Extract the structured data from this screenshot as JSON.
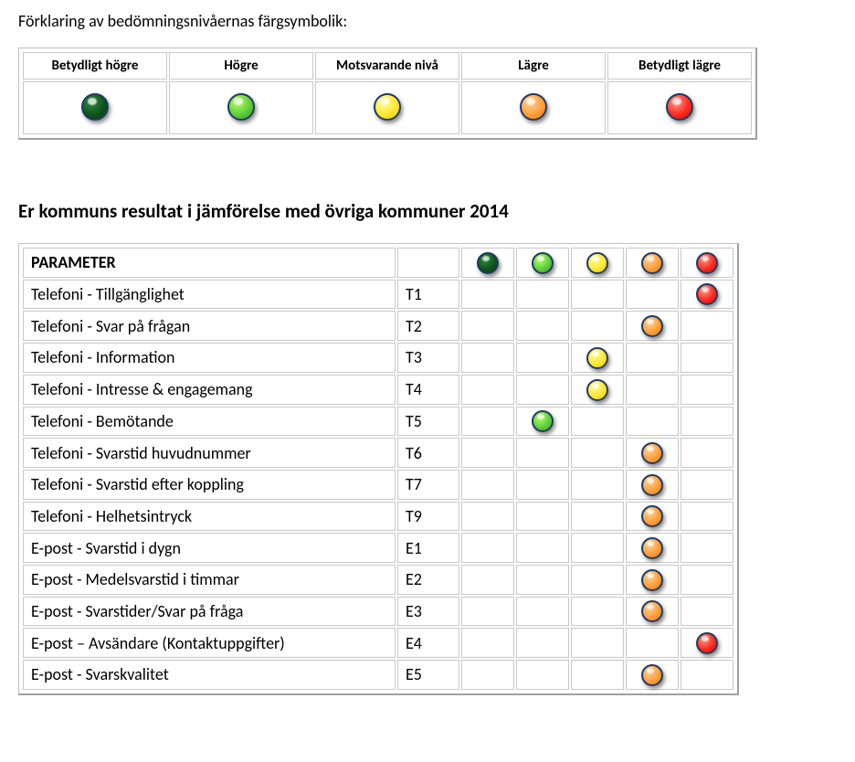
{
  "explain_text": "Förklaring av bedömningsnivåernas färgsymbolik:",
  "legend": {
    "headers": [
      "Betydligt högre",
      "Högre",
      "Motsvarande nivå",
      "Lägre",
      "Betydligt lägre"
    ],
    "colors": [
      "darkgreen",
      "green",
      "yellow",
      "orange",
      "red"
    ]
  },
  "results_heading": "Er kommuns resultat i jämförelse med övriga kommuner 2014",
  "table": {
    "header": {
      "label": "PARAMETER",
      "columns": [
        "darkgreen",
        "green",
        "yellow",
        "orange",
        "red"
      ]
    },
    "rows": [
      {
        "param": "Telefoni - Tillgänglighet",
        "code": "T1",
        "rating": "red"
      },
      {
        "param": "Telefoni - Svar på frågan",
        "code": "T2",
        "rating": "orange"
      },
      {
        "param": "Telefoni - Information",
        "code": "T3",
        "rating": "yellow"
      },
      {
        "param": "Telefoni - Intresse & engagemang",
        "code": "T4",
        "rating": "yellow"
      },
      {
        "param": "Telefoni - Bemötande",
        "code": "T5",
        "rating": "green"
      },
      {
        "param": "Telefoni - Svarstid huvudnummer",
        "code": "T6",
        "rating": "orange"
      },
      {
        "param": "Telefoni - Svarstid efter koppling",
        "code": "T7",
        "rating": "orange"
      },
      {
        "param": "Telefoni - Helhetsintryck",
        "code": "T9",
        "rating": "orange"
      },
      {
        "param": "E-post - Svarstid i dygn",
        "code": "E1",
        "rating": "orange"
      },
      {
        "param": "E-post - Medelsvarstid i timmar",
        "code": "E2",
        "rating": "orange"
      },
      {
        "param": "E-post - Svarstider/Svar på fråga",
        "code": "E3",
        "rating": "orange"
      },
      {
        "param": "E-post – Avsändare (Kontaktuppgifter)",
        "code": "E4",
        "rating": "red"
      },
      {
        "param": "E-post - Svarskvalitet",
        "code": "E5",
        "rating": "orange"
      }
    ]
  },
  "chart_data": {
    "type": "table",
    "title": "Er kommuns resultat i jämförelse med övriga kommuner 2014",
    "rating_scale": [
      "Betydligt högre",
      "Högre",
      "Motsvarande nivå",
      "Lägre",
      "Betydligt lägre"
    ],
    "rating_colors": [
      "darkgreen",
      "green",
      "yellow",
      "orange",
      "red"
    ],
    "rows": [
      {
        "code": "T1",
        "parameter": "Telefoni - Tillgänglighet",
        "rating": "Betydligt lägre"
      },
      {
        "code": "T2",
        "parameter": "Telefoni - Svar på frågan",
        "rating": "Lägre"
      },
      {
        "code": "T3",
        "parameter": "Telefoni - Information",
        "rating": "Motsvarande nivå"
      },
      {
        "code": "T4",
        "parameter": "Telefoni - Intresse & engagemang",
        "rating": "Motsvarande nivå"
      },
      {
        "code": "T5",
        "parameter": "Telefoni - Bemötande",
        "rating": "Högre"
      },
      {
        "code": "T6",
        "parameter": "Telefoni - Svarstid huvudnummer",
        "rating": "Lägre"
      },
      {
        "code": "T7",
        "parameter": "Telefoni - Svarstid efter koppling",
        "rating": "Lägre"
      },
      {
        "code": "T9",
        "parameter": "Telefoni - Helhetsintryck",
        "rating": "Lägre"
      },
      {
        "code": "E1",
        "parameter": "E-post - Svarstid i dygn",
        "rating": "Lägre"
      },
      {
        "code": "E2",
        "parameter": "E-post - Medelsvarstid i timmar",
        "rating": "Lägre"
      },
      {
        "code": "E3",
        "parameter": "E-post - Svarstider/Svar på fråga",
        "rating": "Lägre"
      },
      {
        "code": "E4",
        "parameter": "E-post – Avsändare (Kontaktuppgifter)",
        "rating": "Betydligt lägre"
      },
      {
        "code": "E5",
        "parameter": "E-post - Svarskvalitet",
        "rating": "Lägre"
      }
    ]
  }
}
